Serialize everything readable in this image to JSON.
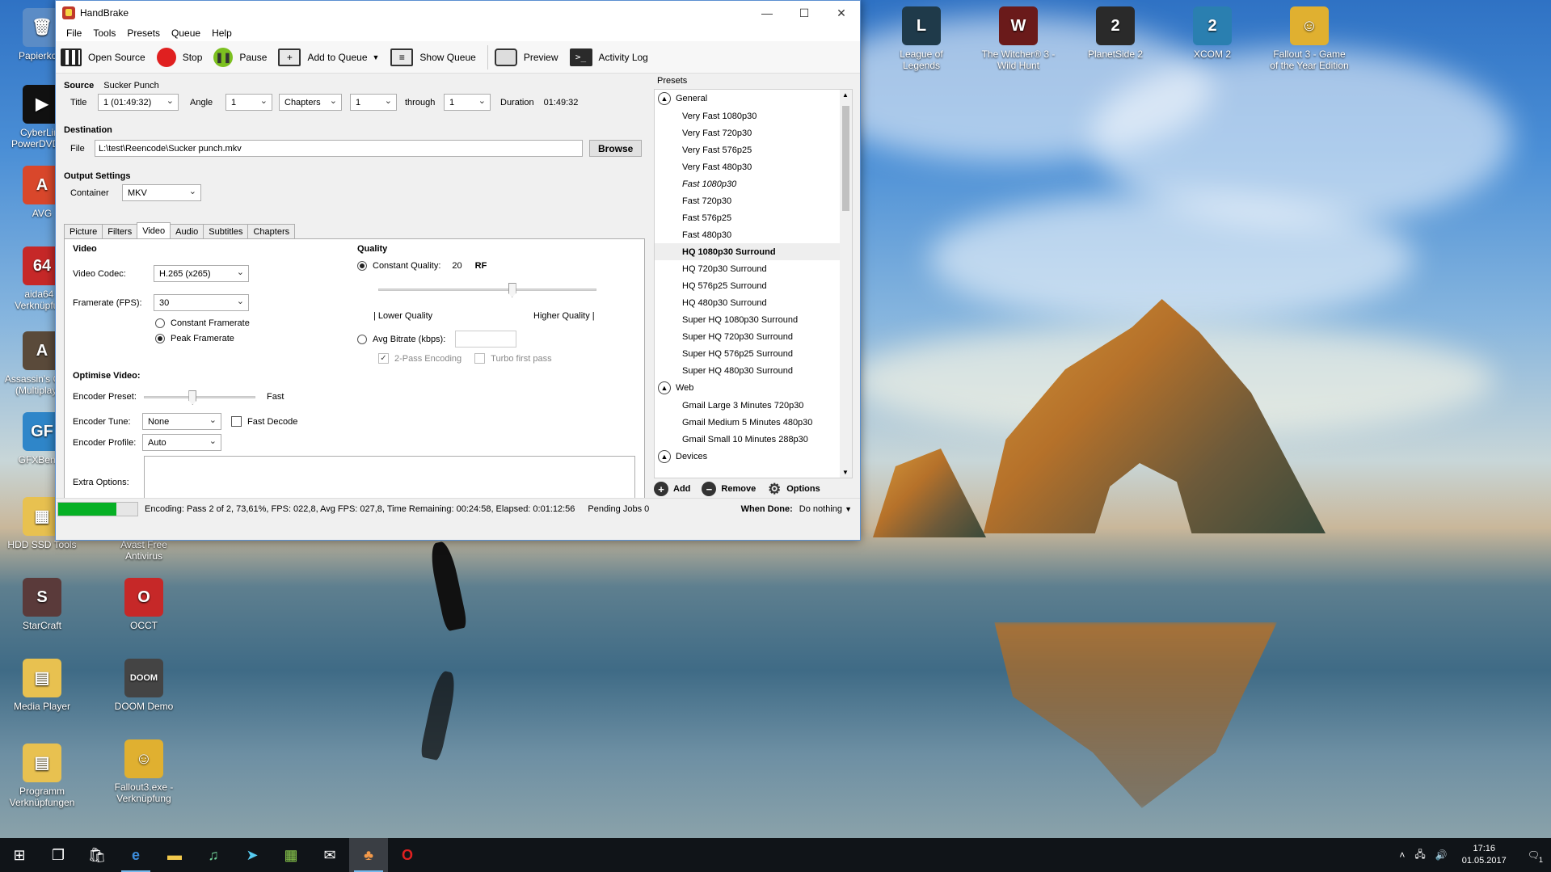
{
  "desktop": {
    "left_icons": [
      {
        "label": "Papierkorb",
        "color": "#5b8cc6",
        "glyph": "🗑"
      },
      {
        "label": "CyberLink PowerDVD 16",
        "color": "#111111",
        "glyph": "▶"
      },
      {
        "label": "AVG",
        "color": "#d9472b",
        "glyph": "A"
      },
      {
        "label": "aida64 - Verknüpfung",
        "color": "#c62828",
        "glyph": "64"
      },
      {
        "label": "Assassin's Creed (Multiplayer)",
        "color": "#5a4a3a",
        "glyph": "A"
      },
      {
        "label": "GFXBench",
        "color": "#2f86c9",
        "glyph": "GF"
      },
      {
        "label": "HDD SSD Tools",
        "color": "#e8c150",
        "glyph": "▦"
      },
      {
        "label": "StarCraft",
        "color": "#5a3a3a",
        "glyph": "S"
      },
      {
        "label": "Media Player",
        "color": "#e8c150",
        "glyph": "▤"
      },
      {
        "label": "Programm Verknüpfungen",
        "color": "#e8c150",
        "glyph": "▤"
      }
    ],
    "second_col_icons": [
      {
        "label": "Avast Free Antivirus",
        "color": "#f47a20",
        "glyph": "a"
      },
      {
        "label": "OCCT",
        "color": "#c62828",
        "glyph": "O"
      },
      {
        "label": "DOOM Demo",
        "color": "#444444",
        "glyph": "DOOM"
      },
      {
        "label": "Fallout3.exe - Verknüpfung",
        "color": "#e0b030",
        "glyph": "☺"
      }
    ],
    "top_icons": [
      {
        "label": "League of Legends",
        "color": "#1f3a4a",
        "glyph": "L"
      },
      {
        "label": "The Witcher® 3 - Wild Hunt",
        "color": "#6a1a1a",
        "glyph": "W"
      },
      {
        "label": "PlanetSide 2",
        "color": "#2a2a2a",
        "glyph": "2"
      },
      {
        "label": "XCOM 2",
        "color": "#2a7fb0",
        "glyph": "2"
      },
      {
        "label": "Fallout 3 - Game of the Year Edition",
        "color": "#e0b030",
        "glyph": "☺"
      }
    ]
  },
  "window": {
    "title": "HandBrake",
    "menu": [
      "File",
      "Tools",
      "Presets",
      "Queue",
      "Help"
    ],
    "toolbar": {
      "open_source": "Open Source",
      "stop": "Stop",
      "pause": "Pause",
      "add_to_queue": "Add to Queue",
      "show_queue": "Show Queue",
      "preview": "Preview",
      "activity_log": "Activity Log"
    },
    "source": {
      "label": "Source",
      "name": "Sucker Punch",
      "title_label": "Title",
      "title_value": "1 (01:49:32)",
      "angle_label": "Angle",
      "angle_value": "1",
      "range_type": "Chapters",
      "range_start": "1",
      "through_label": "through",
      "range_end": "1",
      "duration_label": "Duration",
      "duration_value": "01:49:32"
    },
    "destination": {
      "label": "Destination",
      "file_label": "File",
      "file_value": "L:\\test\\Reencode\\Sucker punch.mkv",
      "browse": "Browse"
    },
    "output": {
      "label": "Output Settings",
      "container_label": "Container",
      "container_value": "MKV"
    },
    "tabs": [
      "Picture",
      "Filters",
      "Video",
      "Audio",
      "Subtitles",
      "Chapters"
    ],
    "active_tab": "Video",
    "video": {
      "section": "Video",
      "codec_label": "Video Codec:",
      "codec_value": "H.265 (x265)",
      "fps_label": "Framerate (FPS):",
      "fps_value": "30",
      "constant_framerate": "Constant Framerate",
      "peak_framerate": "Peak Framerate",
      "optimise": "Optimise Video:",
      "preset_label": "Encoder Preset:",
      "preset_value": "Fast",
      "preset_slider_fraction": 0.43,
      "tune_label": "Encoder Tune:",
      "tune_value": "None",
      "fast_decode": "Fast Decode",
      "profile_label": "Encoder Profile:",
      "profile_value": "Auto",
      "extra_label": "Extra Options:"
    },
    "quality": {
      "section": "Quality",
      "constant_quality": "Constant Quality:",
      "cq_value": "20",
      "cq_unit": "RF",
      "slider_fraction": 0.61,
      "lower": "| Lower Quality",
      "higher": "Higher Quality |",
      "avg_bitrate": "Avg Bitrate (kbps):",
      "two_pass": "2-Pass Encoding",
      "turbo": "Turbo first pass"
    },
    "presets": {
      "label": "Presets",
      "groups": [
        {
          "name": "General",
          "items": [
            "Very Fast 1080p30",
            "Very Fast 720p30",
            "Very Fast 576p25",
            "Very Fast 480p30",
            "Fast 1080p30",
            "Fast 720p30",
            "Fast 576p25",
            "Fast 480p30",
            "HQ 1080p30 Surround",
            "HQ 720p30 Surround",
            "HQ 576p25 Surround",
            "HQ 480p30 Surround",
            "Super HQ 1080p30 Surround",
            "Super HQ 720p30 Surround",
            "Super HQ 576p25 Surround",
            "Super HQ 480p30 Surround"
          ]
        },
        {
          "name": "Web",
          "items": [
            "Gmail Large 3 Minutes 720p30",
            "Gmail Medium 5 Minutes 480p30",
            "Gmail Small 10 Minutes 288p30"
          ]
        },
        {
          "name": "Devices",
          "items": []
        }
      ],
      "selected": "HQ 1080p30 Surround",
      "italic": "Fast 1080p30",
      "add": "Add",
      "remove": "Remove",
      "options": "Options"
    },
    "status": {
      "progress_fraction": 0.7361,
      "text": "Encoding: Pass 2 of 2,  73,61%, FPS: 022,8,  Avg FPS: 027,8,  Time Remaining: 00:24:58,  Elapsed: 0:01:12:56",
      "pending": "Pending Jobs 0",
      "when_done_label": "When Done:",
      "when_done_value": "Do nothing"
    }
  },
  "taskbar": {
    "time": "17:16",
    "date": "01.05.2017",
    "notification_count": "1"
  },
  "colors": {
    "accent": "#5a8fd0",
    "progress": "#06b025",
    "stop": "#e02020",
    "pause": "#7cc020",
    "taskbar": "#101418"
  }
}
